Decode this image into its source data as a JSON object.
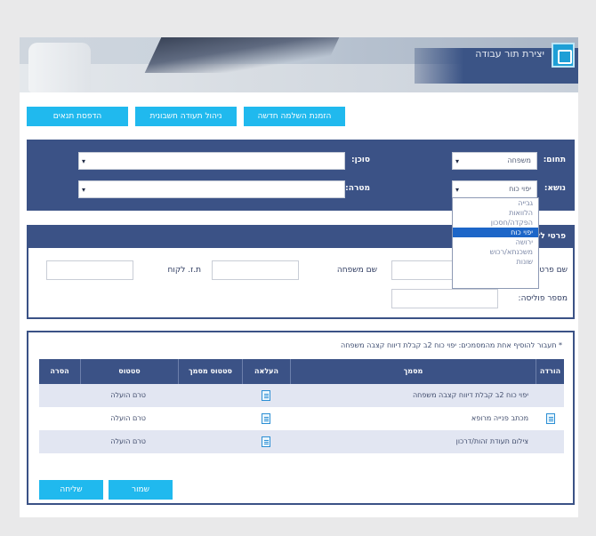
{
  "banner": {
    "title": "יצירת תור עבודה"
  },
  "top_buttons": [
    "הזמנת השלמה חדשה",
    "ניהול תעודה חשבונית",
    "הדפסת תנאים"
  ],
  "search": {
    "domain_label": "תחום:",
    "domain_value": "משפחה",
    "topic_label": "נושא:",
    "topic_value": "יפוי כוח",
    "agent_label": "סוכן:",
    "purpose_label": "מטרה:"
  },
  "dropdown": {
    "options": [
      "גבייה",
      "הלוואות",
      "הפקדה/חסכון",
      "יפוי כוח",
      "ירושה",
      "משכנתא/רכוש",
      "שונות"
    ],
    "selected_index": 3
  },
  "details": {
    "title": "פרטי לקוח",
    "last_name_label": "שם משפחה",
    "first_name_label": "שם פרטי/ראשון",
    "id_label": "ת.ז. לקוח",
    "policy_label": "מספר פוליסה:"
  },
  "docs": {
    "note": "* תעבור להוסיף אחת מהמסמכים: יפוי כוח 2ב קבלת דיווח קצבה משפחה",
    "columns": [
      "הורדה",
      "מסמך",
      "העלאה",
      "סטטוס מסמך",
      "סטטוס",
      "הסרה"
    ],
    "rows": [
      {
        "document": "יפוי כוח 2ב קבלת דיווח קצבה משפחה",
        "status": "טרם הועלה",
        "has_download": false
      },
      {
        "document": "מכתב פנייה מרופא",
        "status": "טרם הועלה",
        "has_download": true
      },
      {
        "document": "צילום תעודת זהות/דרכון",
        "status": "טרם הועלה",
        "has_download": false
      }
    ]
  },
  "bottom_buttons": {
    "save": "שמור",
    "send": "שליחה"
  },
  "colors": {
    "navy": "#3b5286",
    "cyan": "#20b9ee",
    "selected": "#1d66c8"
  }
}
